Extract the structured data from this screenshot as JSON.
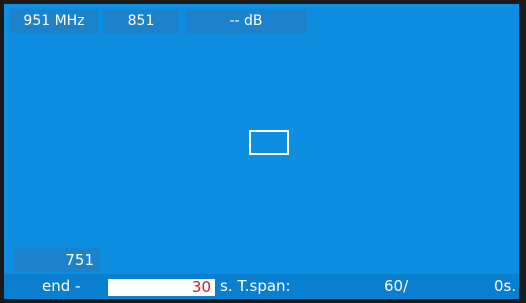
{
  "header": {
    "frequency": "951 MHz",
    "channel_top": "851",
    "level": "-- dB"
  },
  "axis": {
    "channel_bottom": "751"
  },
  "status_bar": {
    "end_label": "end -",
    "end_value": "30",
    "tspan_label": "s. T.span:",
    "tspan_value": "60/",
    "elapsed": "0s."
  },
  "colors": {
    "background": "#0d8ee0",
    "panel": "#1d82cc",
    "input_text": "#d41c1c"
  }
}
